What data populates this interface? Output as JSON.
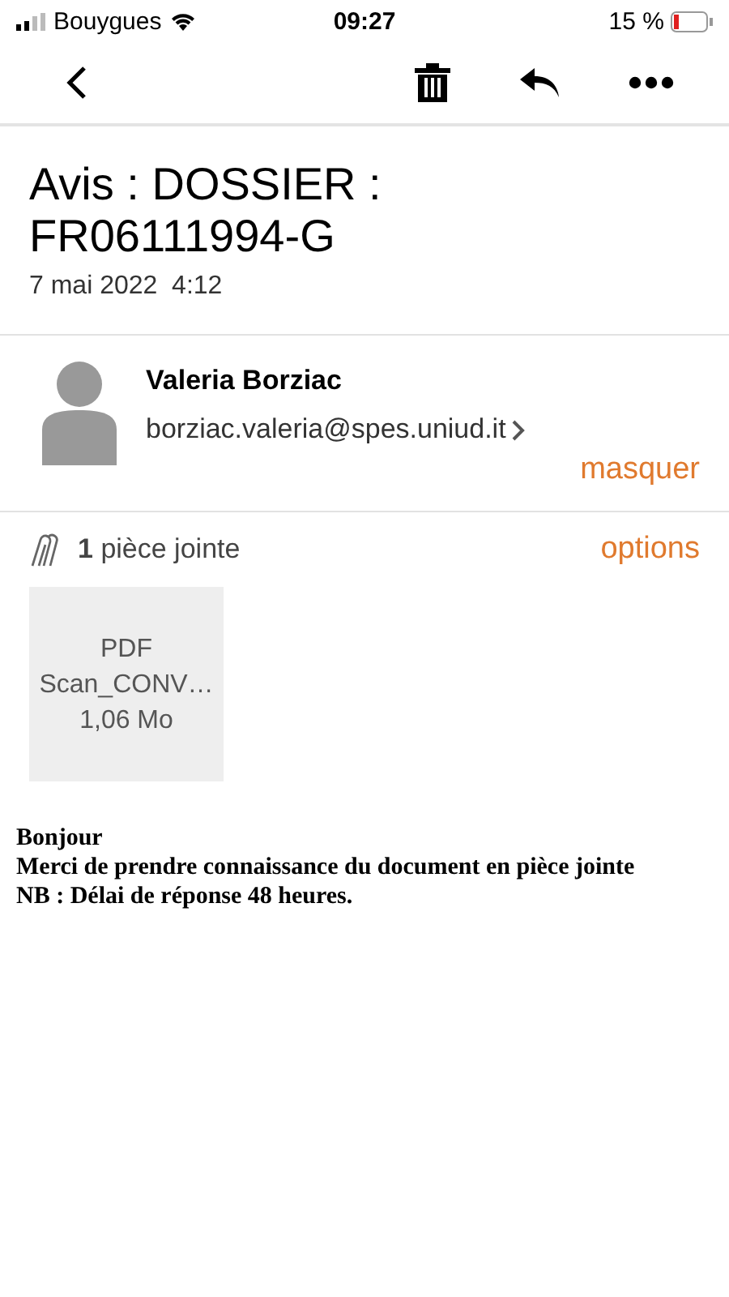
{
  "status_bar": {
    "carrier": "Bouygues",
    "time": "09:27",
    "battery": "15 %"
  },
  "message": {
    "subject": "Avis : DOSSIER : FR06111994-G",
    "date": "7 mai 2022  4:12"
  },
  "sender": {
    "name": "Valeria Borziac",
    "email": "borziac.valeria@spes.uniud.it",
    "hide_link": "masquer"
  },
  "attachments": {
    "count_label": "**1** pièce jointe",
    "options_link": "options",
    "files": [
      {
        "type": "PDF",
        "name": "Scan_CONV…",
        "size": "1,06 Mo"
      }
    ]
  },
  "body": [
    "Bonjour",
    "Merci de prendre connaissance du document en pièce jointe",
    "NB : Délai de réponse 48 heures."
  ]
}
